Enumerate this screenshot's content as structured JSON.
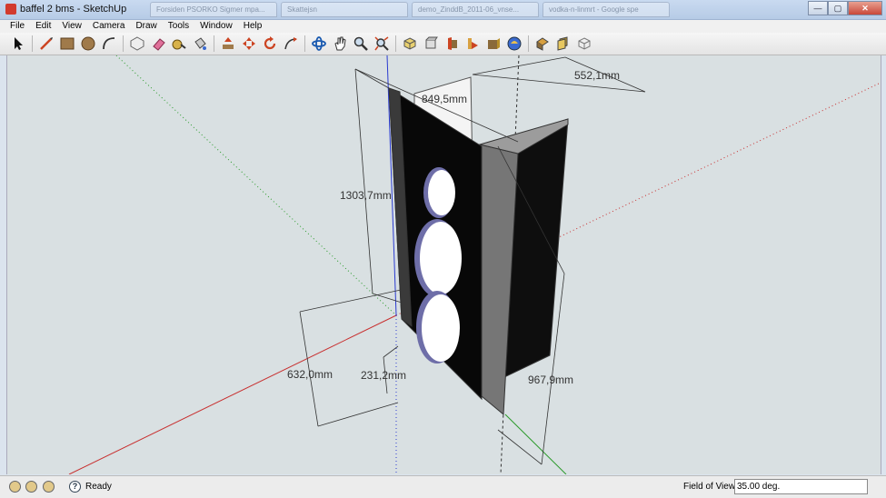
{
  "window": {
    "title": "baffel 2 bms - SketchUp"
  },
  "background_tabs": [
    "Forsiden PSORKO Sigmer mpa...",
    "Skattejsn",
    "demo_ZinddB_2011-06_vnse...",
    "vodka-n-linmrt - Google spe"
  ],
  "menu": [
    "File",
    "Edit",
    "View",
    "Camera",
    "Draw",
    "Tools",
    "Window",
    "Help"
  ],
  "toolbar": {
    "tools": [
      "select-icon",
      "line-icon",
      "rectangle-icon",
      "circle-icon",
      "arc-icon",
      "make-component-icon",
      "eraser-icon",
      "tape-measure-icon",
      "paint-bucket-icon",
      "push-pull-icon",
      "move-icon",
      "rotate-icon",
      "follow-me-icon",
      "orbit-icon",
      "pan-icon",
      "zoom-icon",
      "zoom-extents-icon",
      "iso-view-icon",
      "top-view-icon",
      "front-view-icon",
      "right-view-icon",
      "back-view-icon",
      "left-view-icon",
      "xray-icon",
      "back-edges-icon"
    ]
  },
  "dimensions": {
    "width": "552,1mm",
    "depth": "849,5mm",
    "height": "1303,7mm",
    "lower_height": "632,0mm",
    "hole_offset": "231,2mm",
    "side_height": "967,9mm"
  },
  "status": {
    "text": "Ready",
    "vcb_label": "Field of View",
    "vcb_value": "35.00 deg."
  },
  "colors": {
    "viewport_bg": "#d9e0e2",
    "axis_red": "#c83030",
    "axis_green": "#2a9a2a",
    "axis_blue": "#2a3ad0"
  }
}
